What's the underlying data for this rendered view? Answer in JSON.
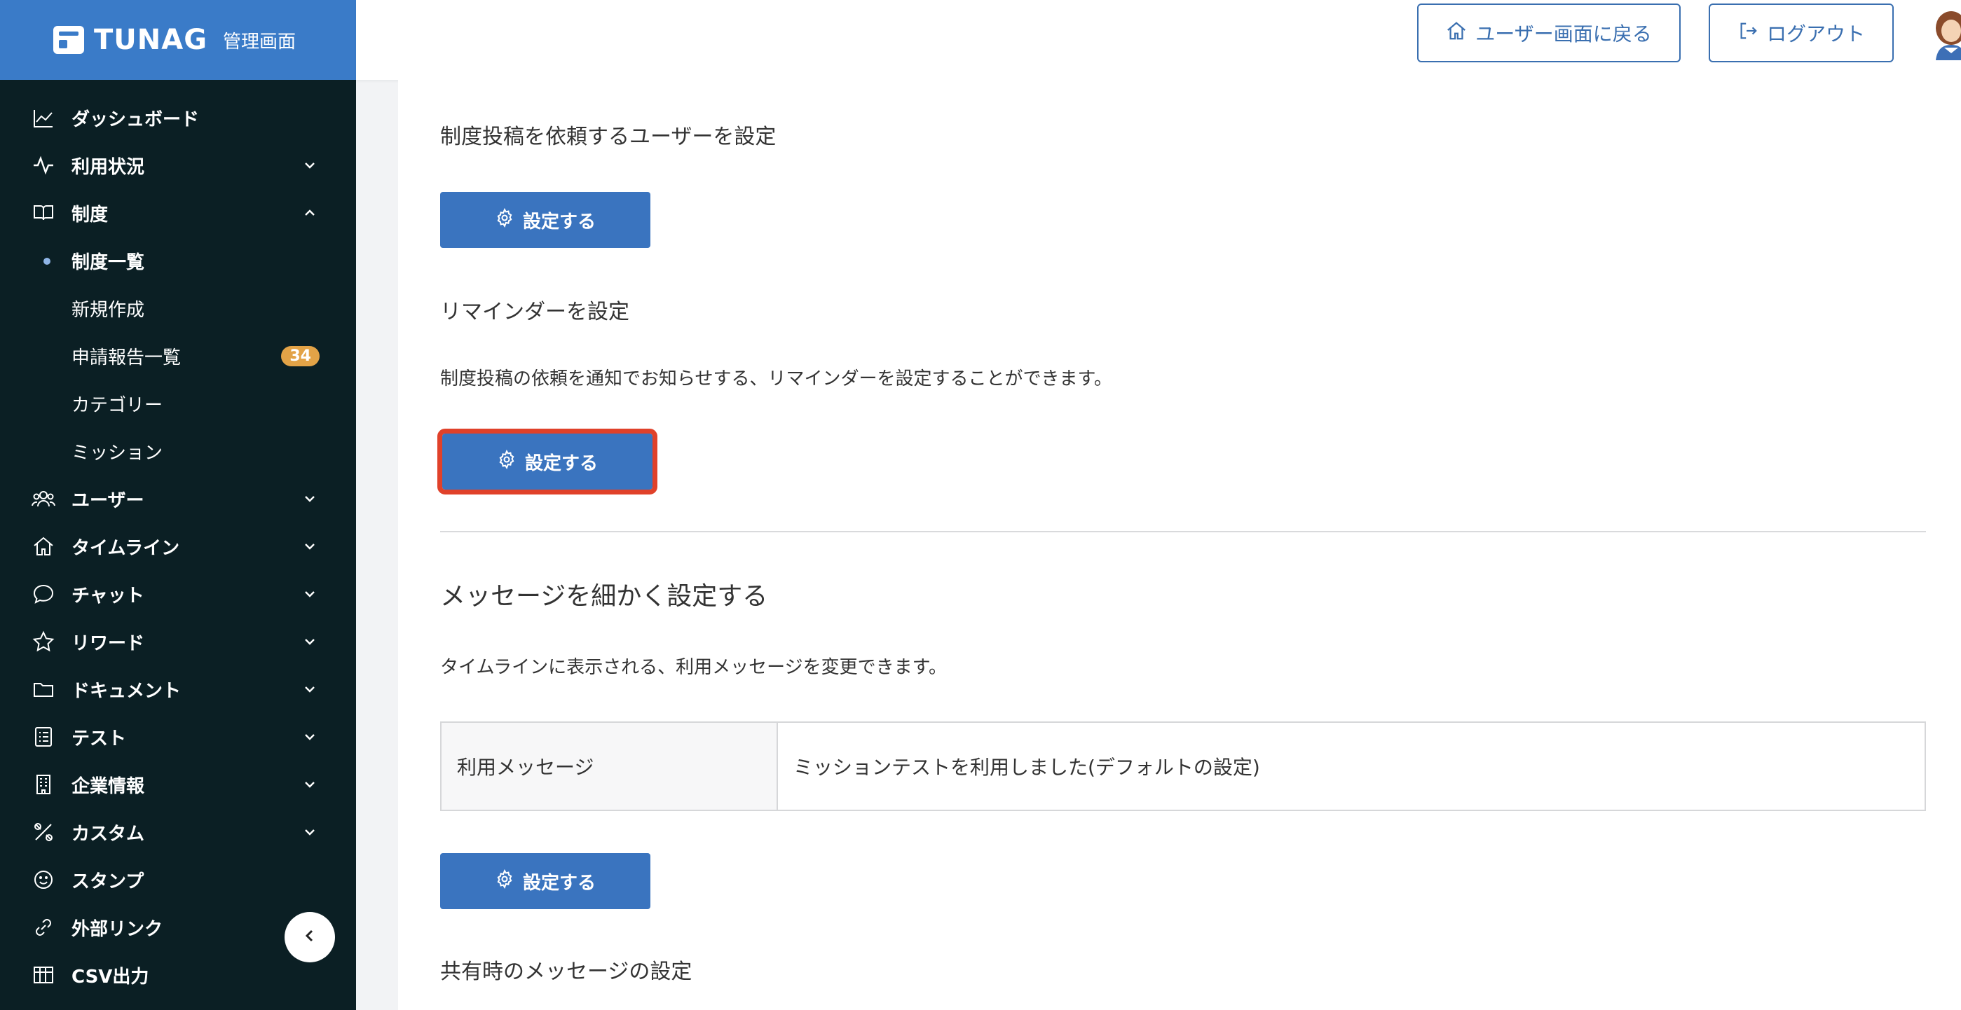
{
  "brand": {
    "name": "TUNAG",
    "subtitle": "管理画面"
  },
  "header": {
    "user_screen_label": "ユーザー画面に戻る",
    "logout_label": "ログアウト"
  },
  "sidebar": {
    "items": [
      {
        "label": "ダッシュボード",
        "icon": "chart-icon"
      },
      {
        "label": "利用状況",
        "icon": "activity-icon"
      },
      {
        "label": "制度",
        "icon": "book-icon"
      },
      {
        "label": "ユーザー",
        "icon": "users-icon"
      },
      {
        "label": "タイムライン",
        "icon": "home-icon"
      },
      {
        "label": "チャット",
        "icon": "chat-icon"
      },
      {
        "label": "リワード",
        "icon": "star-icon"
      },
      {
        "label": "ドキュメント",
        "icon": "folder-icon"
      },
      {
        "label": "テスト",
        "icon": "list-icon"
      },
      {
        "label": "企業情報",
        "icon": "building-icon"
      },
      {
        "label": "カスタム",
        "icon": "tools-icon"
      },
      {
        "label": "スタンプ",
        "icon": "smile-icon"
      },
      {
        "label": "外部リンク",
        "icon": "link-icon"
      },
      {
        "label": "CSV出力",
        "icon": "table-icon"
      }
    ],
    "sub_items": [
      {
        "label": "制度一覧"
      },
      {
        "label": "新規作成"
      },
      {
        "label": "申請報告一覧",
        "badge": "34"
      },
      {
        "label": "カテゴリー"
      },
      {
        "label": "ミッション"
      }
    ]
  },
  "main": {
    "section1_title": "制度投稿を依頼するユーザーを設定",
    "section1_button": "設定する",
    "section2_title": "リマインダーを設定",
    "section2_desc": "制度投稿の依頼を通知でお知らせする、リマインダーを設定することができます。",
    "section2_button": "設定する",
    "section3_title": "メッセージを細かく設定する",
    "section3_desc": "タイムラインに表示される、利用メッセージを変更できます。",
    "table_label": "利用メッセージ",
    "table_value": "ミッションテストを利用しました(デフォルトの設定)",
    "section3_button": "設定する",
    "section4_title": "共有時のメッセージの設定"
  },
  "colors": {
    "sidebar_bg": "#0b1f24",
    "brand_bg": "#3a7bc8",
    "primary_button": "#3a74bf",
    "highlight": "#e0412a",
    "badge": "#e3a347"
  }
}
